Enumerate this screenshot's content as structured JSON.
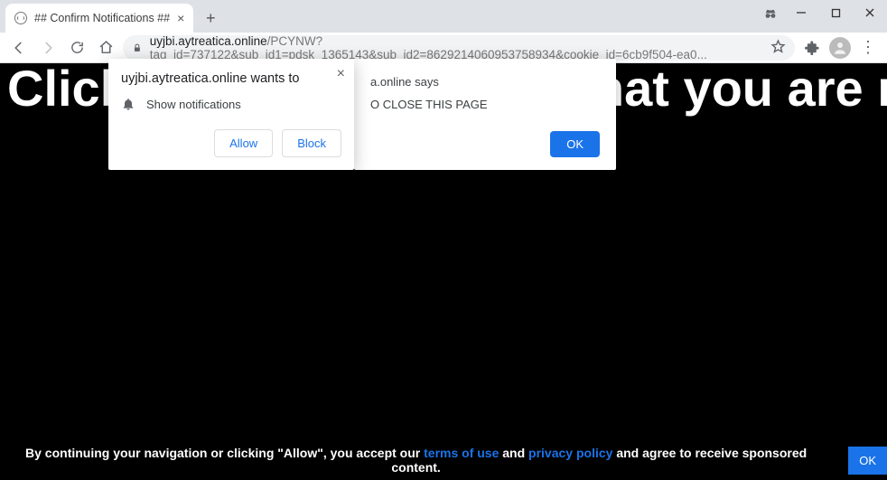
{
  "window": {
    "tab_title": "## Confirm Notifications ##"
  },
  "url": {
    "host": "uyjbi.aytreatica.online",
    "path": "/PCYNW?tag_id=737122&sub_id1=pdsk_1365143&sub_id2=8629214060953758934&cookie_id=6cb9f504-ea0..."
  },
  "page": {
    "hero": "Click 'Allow' to confirm that you are not a",
    "footer_pre": "By continuing your navigation or clicking \"Allow\", you accept our ",
    "footer_terms": "terms of use",
    "footer_and": " and ",
    "footer_privacy": "privacy policy",
    "footer_post": " and agree to receive sponsored content.",
    "footer_ok": "OK"
  },
  "alert": {
    "says_suffix": "a.online says",
    "message_suffix": "O CLOSE THIS PAGE",
    "ok": "OK"
  },
  "perm": {
    "origin_line": "uyjbi.aytreatica.online wants to",
    "capability": "Show notifications",
    "allow": "Allow",
    "block": "Block"
  }
}
